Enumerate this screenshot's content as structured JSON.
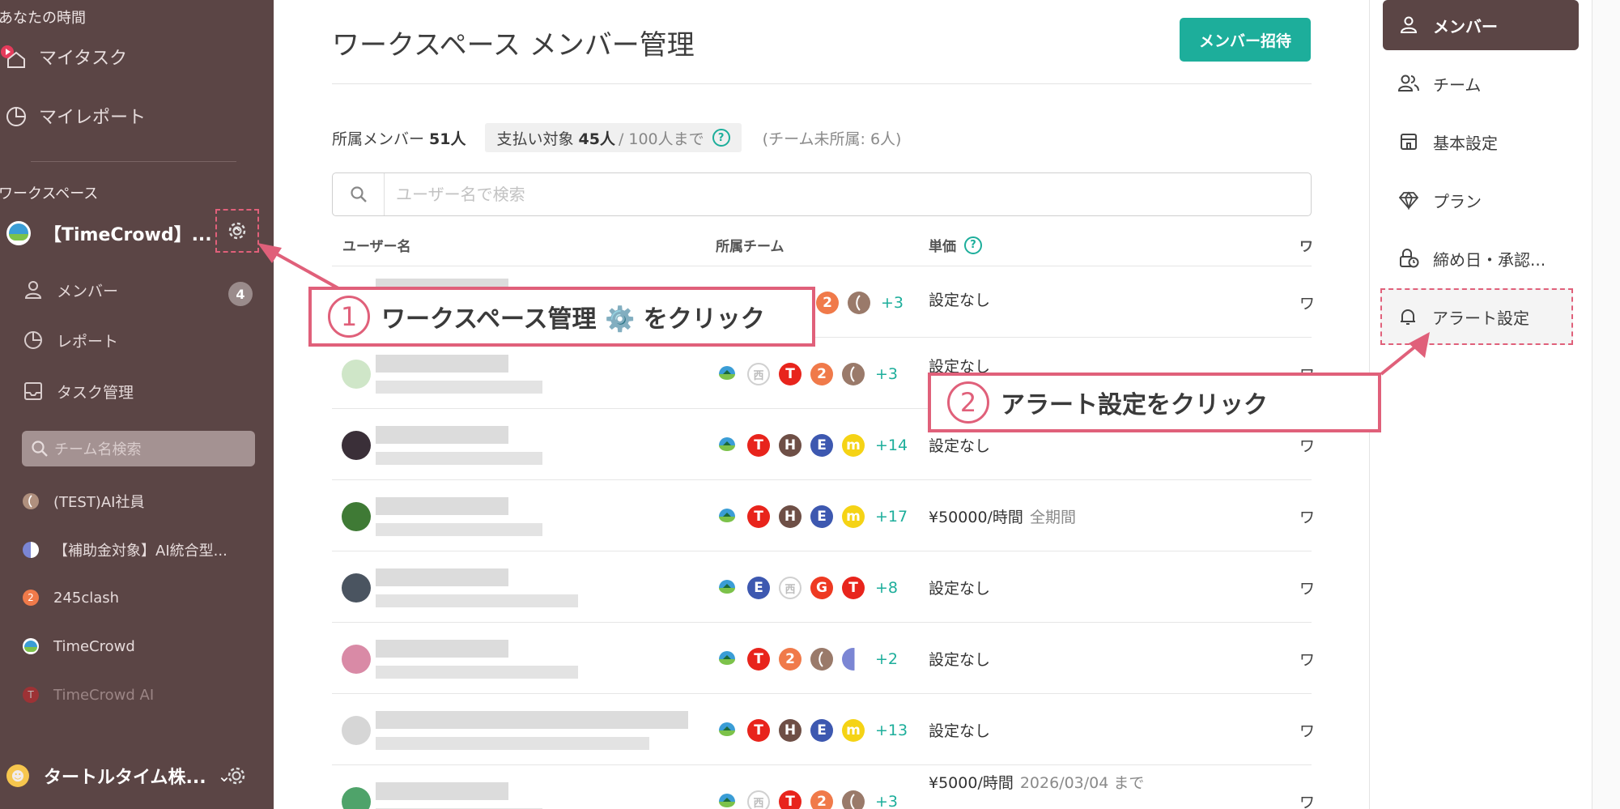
{
  "sidebar": {
    "top_label": "あなたの時間",
    "nav": [
      {
        "label": "マイタスク",
        "icon": "home-icon"
      },
      {
        "label": "マイレポート",
        "icon": "pie-chart-icon"
      }
    ],
    "section_label": "ワークスペース",
    "workspace_name": "【TimeCrowd】...",
    "sub_items": [
      {
        "label": "メンバー",
        "icon": "person-icon",
        "badge": "4"
      },
      {
        "label": "レポート",
        "icon": "pie-chart-icon"
      },
      {
        "label": "タスク管理",
        "icon": "inbox-icon"
      }
    ],
    "team_search_placeholder": "チーム名検索",
    "teams": [
      {
        "label": "(TEST)AI社員",
        "color": "#9a7a6a"
      },
      {
        "label": "【補助金対象】AI統合型...",
        "color": "#7b86d4"
      },
      {
        "label": "245clash",
        "color": "#f07a4a"
      },
      {
        "label": "TimeCrowd",
        "color": "#ffffff"
      },
      {
        "label": "TimeCrowd AI",
        "color": "#c9272c"
      }
    ],
    "company_name": "タートルタイム株..."
  },
  "main": {
    "title": "ワークスペース メンバー管理",
    "invite_label": "メンバー招待",
    "stats": {
      "members_label": "所属メンバー",
      "members_value": "51人",
      "billing_label": "支払い対象",
      "billing_value": "45人",
      "billing_limit": "/ 100人まで",
      "unassigned": "(チーム未所属: 6人)"
    },
    "search_placeholder": "ユーザー名で検索",
    "columns": [
      "ユーザー名",
      "所属チーム",
      "単価",
      "ワ"
    ],
    "rows": [
      {
        "teams": [
          "two",
          "coffee"
        ],
        "more": "+3",
        "price": "設定なし",
        "note": ""
      },
      {
        "teams": [
          "turtle",
          "west",
          "T",
          "two",
          "coffee"
        ],
        "more": "+3",
        "price": "設定なし",
        "note": ""
      },
      {
        "teams": [
          "turtle",
          "T",
          "H",
          "E",
          "m"
        ],
        "more": "+14",
        "price": "設定なし",
        "note": ""
      },
      {
        "teams": [
          "turtle",
          "T",
          "H",
          "E",
          "m"
        ],
        "more": "+17",
        "price": "¥50000/時間",
        "note": "全期間"
      },
      {
        "teams": [
          "turtle",
          "E",
          "west",
          "G",
          "T"
        ],
        "more": "+8",
        "price": "設定なし",
        "note": ""
      },
      {
        "teams": [
          "turtle",
          "T",
          "two",
          "coffee",
          "half"
        ],
        "more": "+2",
        "price": "設定なし",
        "note": ""
      },
      {
        "teams": [
          "turtle",
          "T",
          "H",
          "E",
          "m"
        ],
        "more": "+13",
        "price": "設定なし",
        "note": ""
      },
      {
        "teams": [
          "turtle",
          "west",
          "T",
          "two",
          "coffee"
        ],
        "more": "+3",
        "price": "¥5000/時間",
        "note": "2026/03/04 まで"
      }
    ],
    "team_glyphs": {
      "T": "T",
      "H": "H",
      "E": "E",
      "m": "m",
      "G": "G",
      "two": "2",
      "west": "西"
    }
  },
  "right_panel": {
    "items": [
      {
        "label": "メンバー",
        "icon": "person-icon"
      },
      {
        "label": "チーム",
        "icon": "people-icon"
      },
      {
        "label": "基本設定",
        "icon": "building-icon"
      },
      {
        "label": "プラン",
        "icon": "diamond-icon"
      },
      {
        "label": "締め日・承認...",
        "icon": "lock-clock-icon"
      },
      {
        "label": "アラート設定",
        "icon": "bell-icon"
      }
    ]
  },
  "callouts": {
    "one_num": "1",
    "one_text": "ワークスペース管理 ⚙️ をクリック",
    "two_num": "2",
    "two_text": "アラート設定をクリック"
  },
  "colors": {
    "sidebar_bg": "#5b4545",
    "accent": "#1dae9b",
    "callout": "#e0607a"
  }
}
